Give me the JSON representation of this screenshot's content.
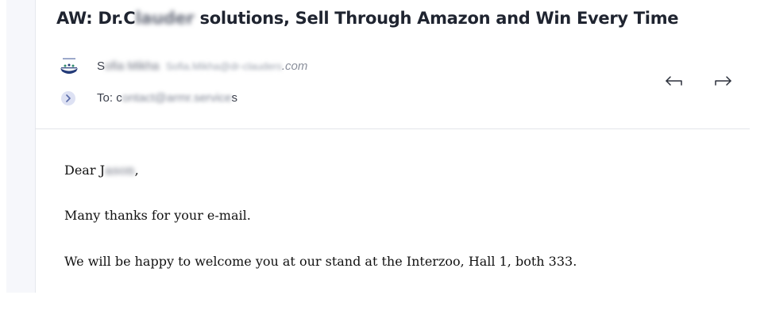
{
  "email": {
    "subject_prefix": "AW: Dr.C",
    "subject_blurred": "lauder",
    "subject_rest": " solutions, Sell Through Amazon and Win Every Time",
    "sender": {
      "avatar": "dr-clauders-logo",
      "name_initial": "S",
      "name_blurred": "ofia Mikha",
      "email_blurred": "Sofia.Mikha@dr-clauders",
      "email_tail": ".com"
    },
    "recipient": {
      "label": "To: ",
      "first_char": "c",
      "address_blurred": "ontact@armr.service",
      "last_char": "s"
    },
    "actions": {
      "reply_icon": "reply-arrow-icon",
      "forward_icon": "forward-arrow-icon",
      "expand_icon": "chevron-right-icon"
    },
    "body": {
      "greeting_start": "Dear J",
      "greeting_blurred": "ason",
      "greeting_end": ",",
      "line2": "Many thanks for your e-mail.",
      "line3": "We will be happy to welcome you at our stand at the Interzoo, Hall 1, both 333."
    }
  },
  "colors": {
    "accent_badge": "#dde1f3",
    "divider": "#e3e5ea",
    "text_primary": "#1f2430"
  }
}
